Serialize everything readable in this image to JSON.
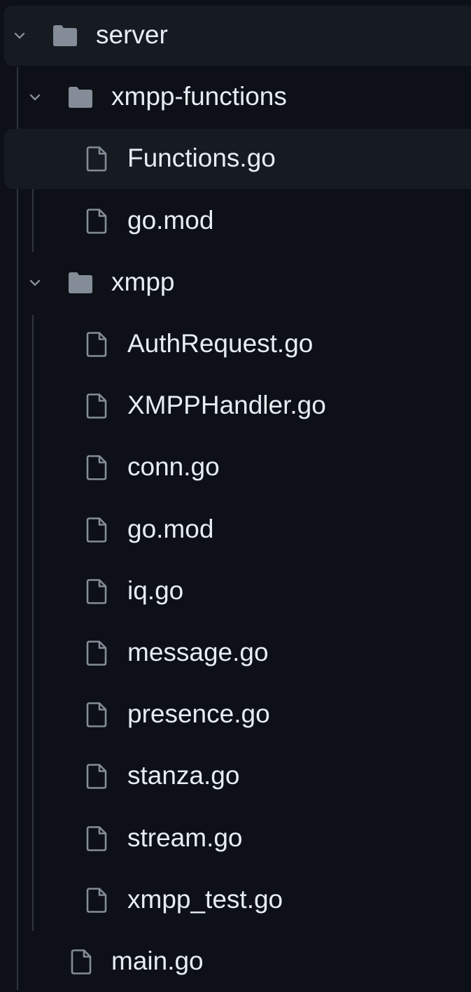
{
  "tree": [
    {
      "label": "server",
      "type": "folder",
      "depth": 0,
      "expanded": true,
      "selected": true
    },
    {
      "label": "xmpp-functions",
      "type": "folder",
      "depth": 1,
      "expanded": true,
      "selected": false
    },
    {
      "label": "Functions.go",
      "type": "file",
      "depth": 2,
      "selected": true
    },
    {
      "label": "go.mod",
      "type": "file",
      "depth": 2,
      "selected": false
    },
    {
      "label": "xmpp",
      "type": "folder",
      "depth": 1,
      "expanded": true,
      "selected": false
    },
    {
      "label": "AuthRequest.go",
      "type": "file",
      "depth": 2,
      "selected": false
    },
    {
      "label": "XMPPHandler.go",
      "type": "file",
      "depth": 2,
      "selected": false
    },
    {
      "label": "conn.go",
      "type": "file",
      "depth": 2,
      "selected": false
    },
    {
      "label": "go.mod",
      "type": "file",
      "depth": 2,
      "selected": false
    },
    {
      "label": "iq.go",
      "type": "file",
      "depth": 2,
      "selected": false
    },
    {
      "label": "message.go",
      "type": "file",
      "depth": 2,
      "selected": false
    },
    {
      "label": "presence.go",
      "type": "file",
      "depth": 2,
      "selected": false
    },
    {
      "label": "stanza.go",
      "type": "file",
      "depth": 2,
      "selected": false
    },
    {
      "label": "stream.go",
      "type": "file",
      "depth": 2,
      "selected": false
    },
    {
      "label": "xmpp_test.go",
      "type": "file",
      "depth": 2,
      "selected": false
    },
    {
      "label": "main.go",
      "type": "file",
      "depth": 1,
      "selected": false
    }
  ],
  "icons": {
    "folder": "folder-icon",
    "file": "file-icon",
    "chevron": "chevron-down-icon"
  },
  "colors": {
    "background": "#0d1117",
    "selected_row": "#161b22",
    "text": "#e6edf3",
    "icon": "#848d97",
    "guide": "#30363d"
  }
}
